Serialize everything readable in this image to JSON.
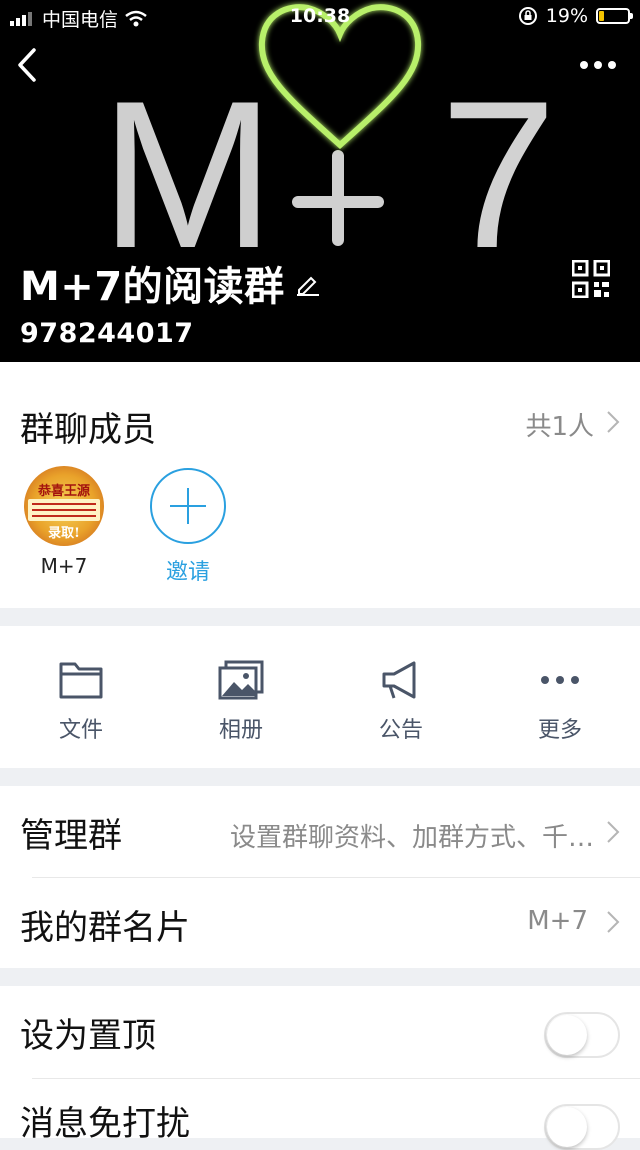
{
  "status_bar": {
    "carrier": "中国电信",
    "time": "10:38",
    "battery": "19%",
    "battery_level": 0.19
  },
  "header": {
    "art_letters": [
      "M",
      "7"
    ],
    "group_name": "M+7的阅读群",
    "group_id": "978244017"
  },
  "members": {
    "title": "群聊成员",
    "count": "共1人",
    "list": [
      {
        "name": "M+7",
        "avatar_text": [
          "恭喜王源",
          "录取!"
        ]
      }
    ],
    "invite_label": "邀请"
  },
  "actions": [
    {
      "label": "文件",
      "icon": "folder-icon"
    },
    {
      "label": "相册",
      "icon": "photo-album-icon"
    },
    {
      "label": "公告",
      "icon": "megaphone-icon"
    },
    {
      "label": "更多",
      "icon": "more-dots-icon"
    }
  ],
  "settings": {
    "manage_label": "管理群",
    "manage_value": "设置群聊资料、加群方式、千…",
    "card_label": "我的群名片",
    "card_value": "M+7",
    "pin_label": "设为置顶",
    "pin_on": false,
    "mute_label": "消息免打扰",
    "mute_on": false
  },
  "colors": {
    "accent": "#2aa0e0",
    "heart_glow": "#b8f06a",
    "battery_fill": "#f5c400"
  }
}
